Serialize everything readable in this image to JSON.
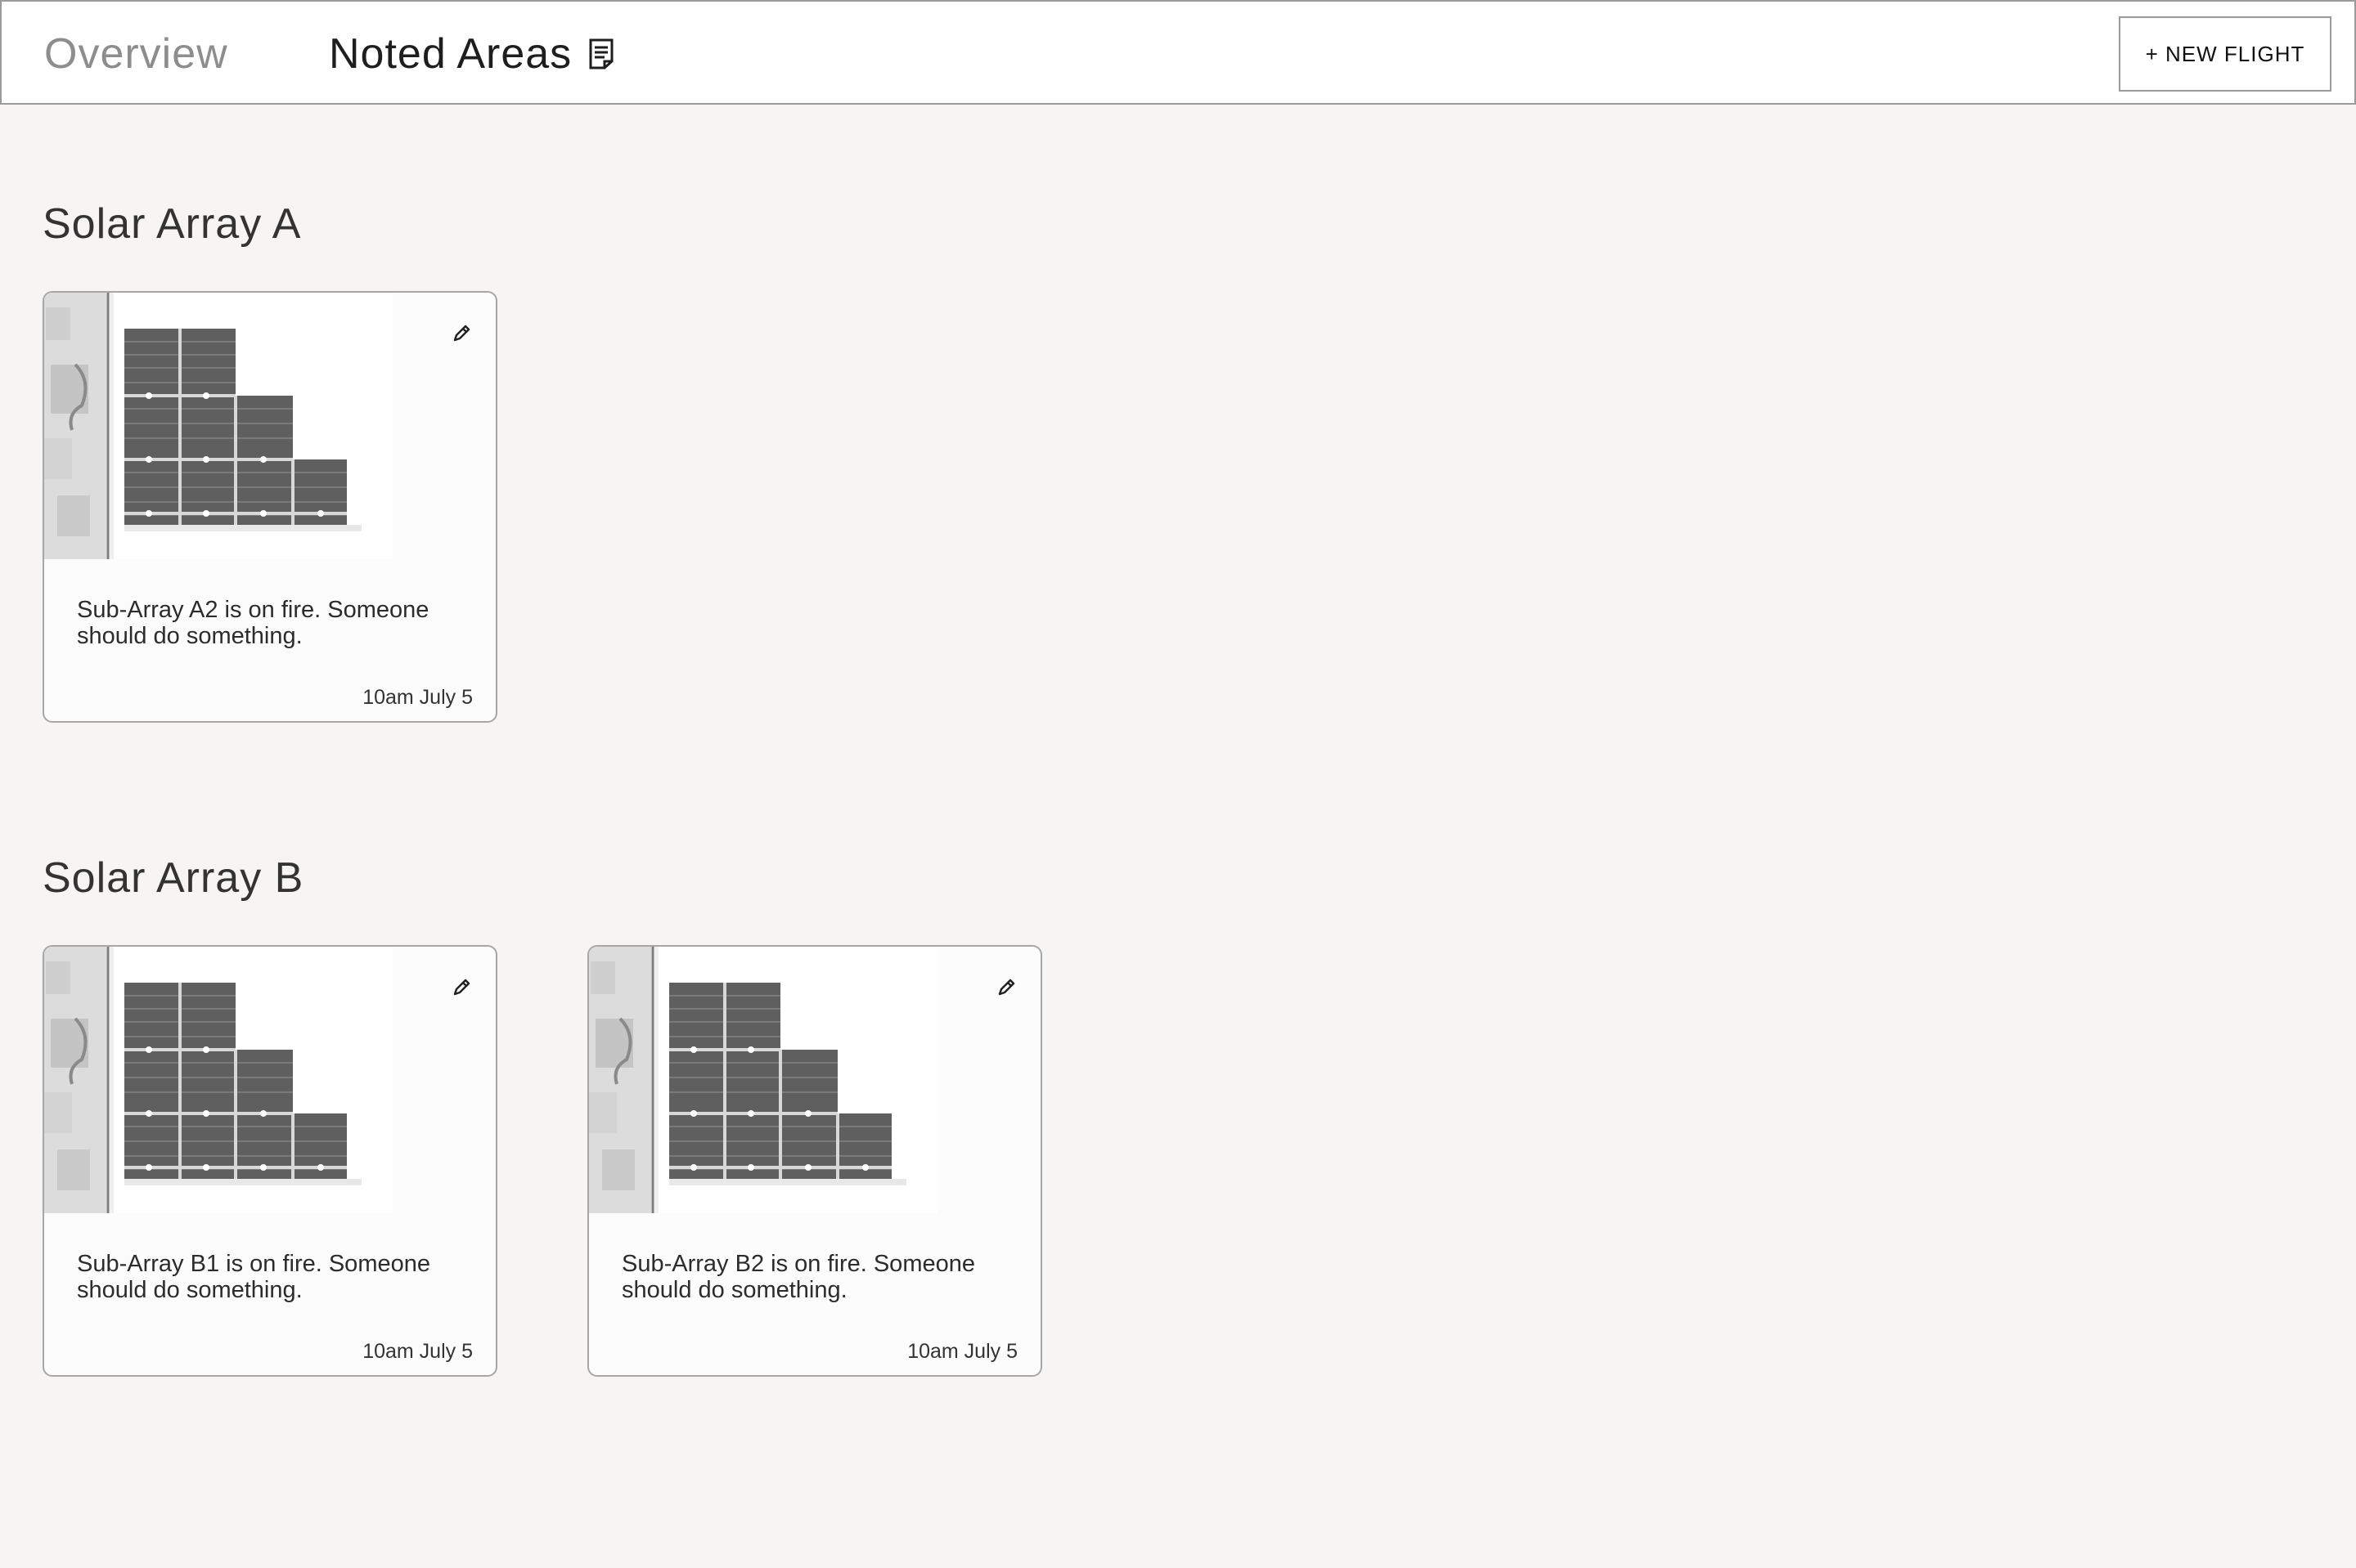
{
  "header": {
    "tabs": [
      {
        "label": "Overview",
        "active": false
      },
      {
        "label": "Noted Areas",
        "active": true,
        "icon": "note-icon"
      }
    ],
    "new_flight_label": "+ NEW FLIGHT"
  },
  "sections": [
    {
      "title": "Solar Array A",
      "cards": [
        {
          "note": "Sub-Array A2 is on fire. Someone should do something.",
          "time": "10am July 5",
          "edit_icon": "pencil-icon"
        }
      ]
    },
    {
      "title": "Solar Array B",
      "cards": [
        {
          "note": "Sub-Array B1 is on fire. Someone should do something.",
          "time": "10am July 5",
          "edit_icon": "pencil-icon"
        },
        {
          "note": "Sub-Array B2 is on fire. Someone should do something.",
          "time": "10am July 5",
          "edit_icon": "pencil-icon"
        }
      ]
    }
  ],
  "colors": {
    "background": "#f6f5f3",
    "card_border": "#a7a7a7",
    "inactive_tab": "#8d8d8d",
    "active_tab": "#1e1e1e"
  }
}
